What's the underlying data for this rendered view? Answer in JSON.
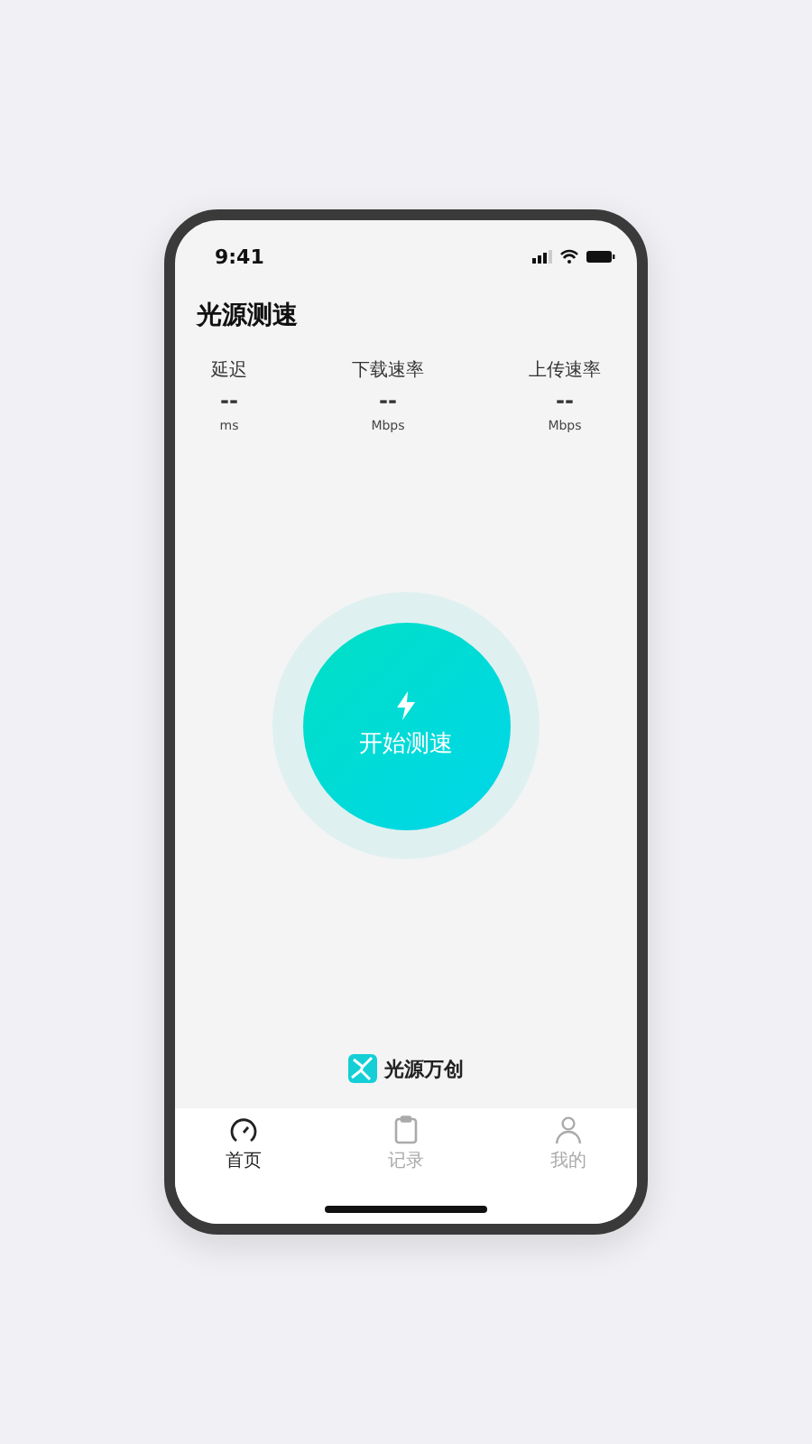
{
  "status_bar": {
    "time": "9:41"
  },
  "title": "光源测速",
  "stats": [
    {
      "label": "延迟",
      "value": "--",
      "unit": "ms"
    },
    {
      "label": "下载速率",
      "value": "--",
      "unit": "Mbps"
    },
    {
      "label": "上传速率",
      "value": "--",
      "unit": "Mbps"
    }
  ],
  "start_button": {
    "label": "开始测速"
  },
  "brand": {
    "name": "光源万创"
  },
  "tabs": [
    {
      "label": "首页",
      "selected": true,
      "kind": "gauge"
    },
    {
      "label": "记录",
      "selected": false,
      "kind": "clipboard"
    },
    {
      "label": "我的",
      "selected": false,
      "kind": "person"
    }
  ]
}
